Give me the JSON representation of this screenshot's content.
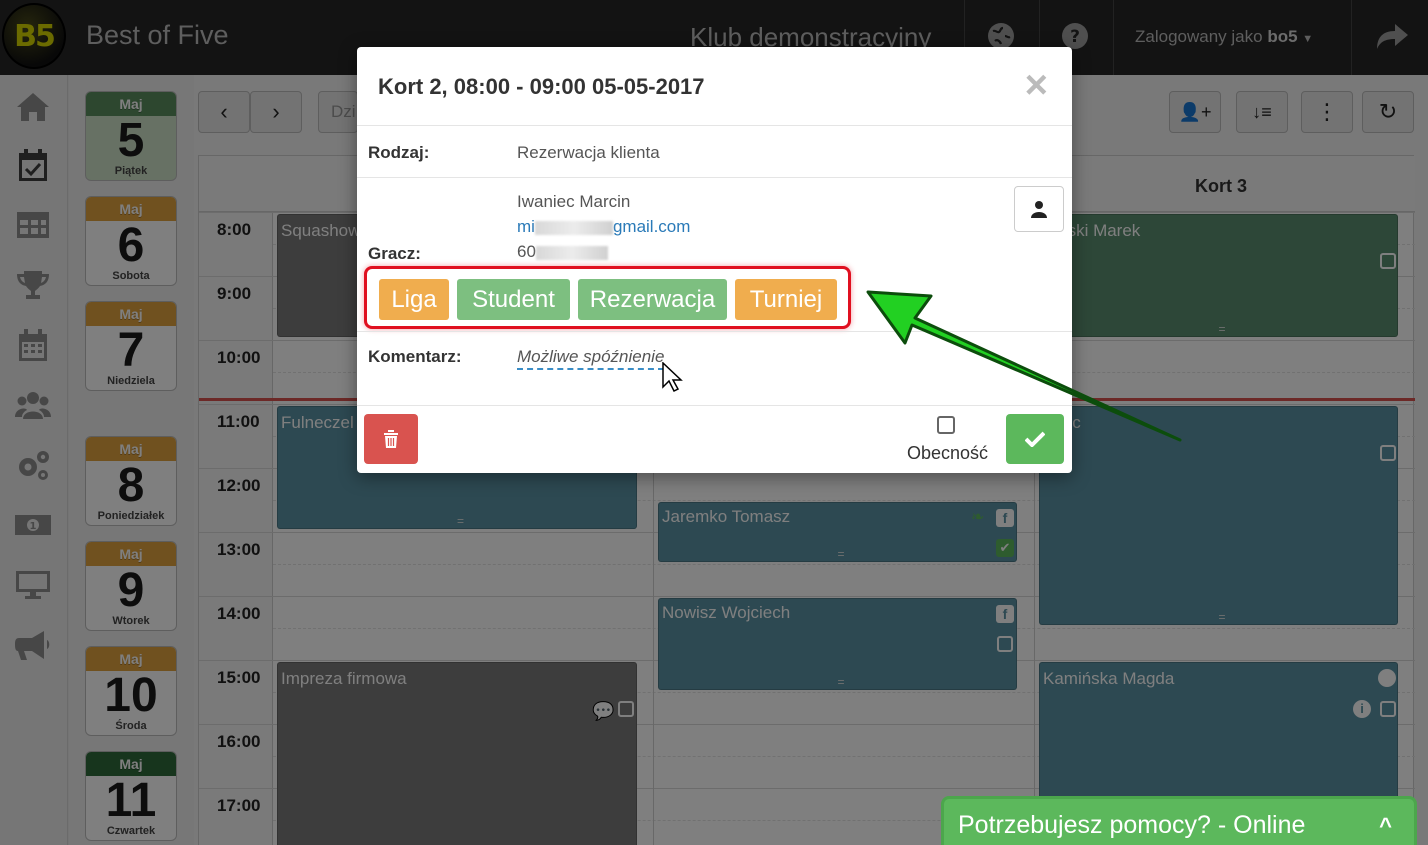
{
  "app": {
    "logo_text": "B5",
    "title": "Best of Five",
    "club": "Klub demonstracyjny",
    "user_prefix": "Zalogowany jako",
    "user_name": "bo5"
  },
  "sidebar": {
    "items": [
      "home-icon",
      "calendar-check-icon",
      "table-icon",
      "trophy-icon",
      "calendar-icon",
      "users-icon",
      "cogs-icon",
      "money-icon",
      "desktop-icon",
      "bullhorn-icon"
    ]
  },
  "days": [
    {
      "month": "Maj",
      "day": "5",
      "weekday": "Piątek",
      "color": "#5a8f5e",
      "today": true
    },
    {
      "month": "Maj",
      "day": "6",
      "weekday": "Sobota",
      "color": "#e1a23f"
    },
    {
      "month": "Maj",
      "day": "7",
      "weekday": "Niedziela",
      "color": "#e1a23f"
    },
    {
      "month": "Maj",
      "day": "8",
      "weekday": "Poniedziałek",
      "color": "#e1a23f"
    },
    {
      "month": "Maj",
      "day": "9",
      "weekday": "Wtorek",
      "color": "#e1a23f"
    },
    {
      "month": "Maj",
      "day": "10",
      "weekday": "Środa",
      "color": "#e1a23f"
    },
    {
      "month": "Maj",
      "day": "11",
      "weekday": "Czwartek",
      "color": "#2e6a3a"
    }
  ],
  "toolbar": {
    "prev": "‹",
    "next": "›",
    "today_partial": "Dzi"
  },
  "schedule": {
    "court3_header": "Kort 3",
    "times": [
      "8:00",
      "9:00",
      "10:00",
      "11:00",
      "12:00",
      "13:00",
      "14:00",
      "15:00",
      "16:00",
      "17:00"
    ],
    "events": {
      "squash": "Squashow",
      "fulneczek": "Fulneczel",
      "impreza": "Impreza firmowa",
      "jaremko": "Jaremko Tomasz",
      "nowisz": "Nowisz Wojciech",
      "marski": "narski Marek",
      "marc": "Marc",
      "kaminska": "Kamińska Magda"
    }
  },
  "modal": {
    "title": "Kort 2, 08:00 - 09:00 05-05-2017",
    "close": "×",
    "type_label": "Rodzaj:",
    "type_value": "Rezerwacja klienta",
    "player_label": "Gracz:",
    "player_name": "Iwaniec Marcin",
    "email_prefix": "mi",
    "email_suffix": "gmail.com",
    "phone_prefix": "60",
    "tags": [
      {
        "label": "Liga",
        "color": "#f0ad4e"
      },
      {
        "label": "Student",
        "color": "#7dbf80"
      },
      {
        "label": "Rezerwacja",
        "color": "#7dbf80"
      },
      {
        "label": "Turniej",
        "color": "#f0ad4e"
      }
    ],
    "comment_label": "Komentarz:",
    "comment_value": "Możliwe spóźnienie",
    "attendance_label": "Obecność"
  },
  "help": {
    "text": "Potrzebujesz pomocy? - Online",
    "chevron": "^"
  }
}
